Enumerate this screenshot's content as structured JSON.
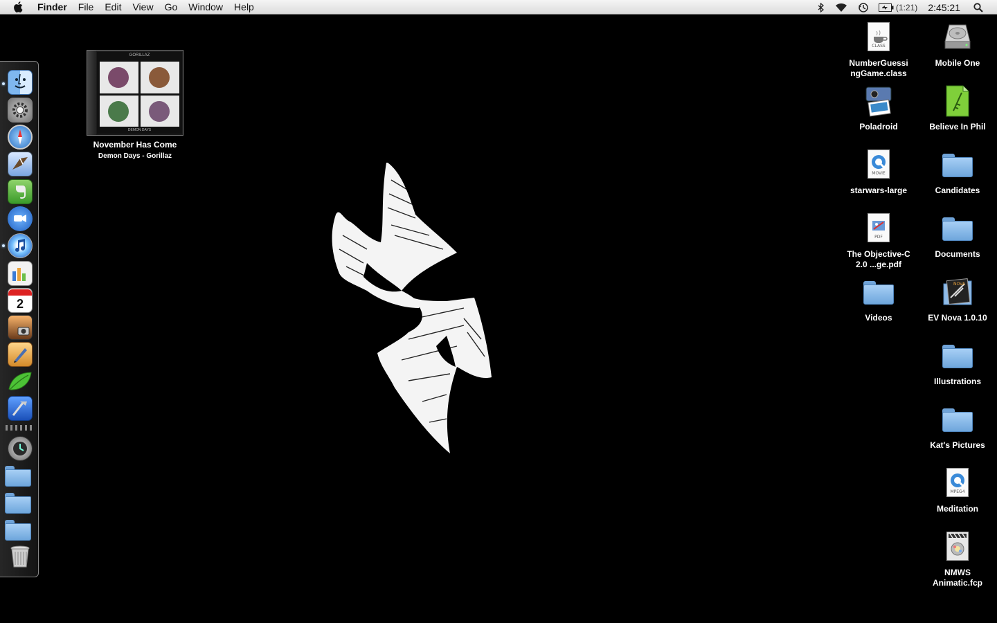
{
  "menubar": {
    "app_name": "Finder",
    "menus": [
      "File",
      "Edit",
      "View",
      "Go",
      "Window",
      "Help"
    ],
    "battery_time": "(1:21)",
    "clock": "2:45:21"
  },
  "dock": {
    "apps": [
      {
        "name": "finder",
        "running": true
      },
      {
        "name": "system-preferences",
        "running": false
      },
      {
        "name": "safari",
        "running": false
      },
      {
        "name": "mail",
        "running": false
      },
      {
        "name": "evernote",
        "running": false
      },
      {
        "name": "ichat",
        "running": false
      },
      {
        "name": "itunes",
        "running": true
      },
      {
        "name": "numbers",
        "running": false
      },
      {
        "name": "ical",
        "running": false,
        "badge_text": "2"
      },
      {
        "name": "iphoto",
        "running": false
      },
      {
        "name": "pages",
        "running": false
      },
      {
        "name": "coda",
        "running": false
      },
      {
        "name": "xcode",
        "running": false
      }
    ],
    "stacks": [
      "time-machine",
      "applications",
      "documents",
      "downloads",
      "trash"
    ]
  },
  "now_playing": {
    "title": "November Has Come",
    "subtitle": "Demon Days - Gorillaz",
    "album_text": "GORILLAZ",
    "album_sub": "DEMON DAYS"
  },
  "desktop_icons": {
    "right_column_1": [
      {
        "label": "NumberGuessi ngGame.class",
        "type": "class-file",
        "tag": "CLASS"
      },
      {
        "label": "Poladroid",
        "type": "app"
      },
      {
        "label": "starwars-large",
        "type": "movie-file",
        "tag": "MOVIE"
      },
      {
        "label": "The Objective-C 2.0 ...ge.pdf",
        "type": "pdf-file",
        "tag": "PDF"
      },
      {
        "label": "Videos",
        "type": "folder"
      }
    ],
    "right_column_2": [
      {
        "label": "Mobile One",
        "type": "drive"
      },
      {
        "label": "Believe In Phil",
        "type": "document"
      },
      {
        "label": "Candidates",
        "type": "folder"
      },
      {
        "label": "Documents",
        "type": "folder"
      },
      {
        "label": "EV Nova 1.0.10",
        "type": "app-folder"
      },
      {
        "label": "Illustrations",
        "type": "folder"
      },
      {
        "label": "Kat's Pictures",
        "type": "folder"
      },
      {
        "label": "Meditation",
        "type": "mpeg-file",
        "tag": "MPEG4"
      },
      {
        "label": "NMWS Animatic.fcp",
        "type": "fcp-file"
      }
    ]
  },
  "colors": {
    "desktop_bg": "#000000",
    "folder_blue": "#8fbbe8",
    "label_text": "#ffffff"
  }
}
